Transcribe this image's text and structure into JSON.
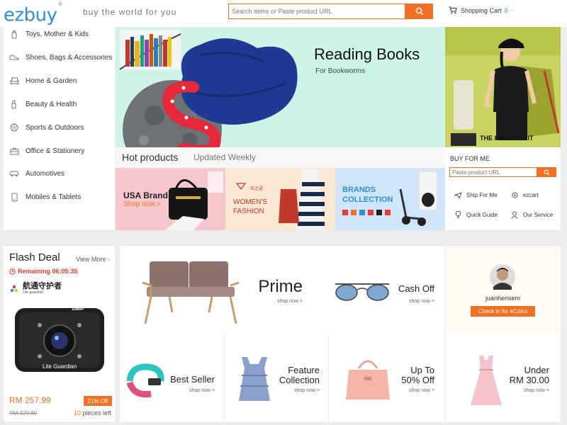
{
  "header": {
    "logo": "ezbuy",
    "logo_mark": "®",
    "tagline": "buy the world for you",
    "search_placeholder": "Search items or Paste product URL",
    "cart_label": "Shopping Cart",
    "cart_count": "0"
  },
  "sidebar": {
    "items": [
      {
        "label": "Toys, Mother & Kids",
        "icon": "baby-bottle-icon"
      },
      {
        "label": "Shoes, Bags & Accessories",
        "icon": "shoe-icon"
      },
      {
        "label": "Home & Garden",
        "icon": "sofa-icon"
      },
      {
        "label": "Beauty & Health",
        "icon": "cosmetics-icon"
      },
      {
        "label": "Sports & Outdoors",
        "icon": "ball-icon"
      },
      {
        "label": "Office & Stationery",
        "icon": "briefcase-icon"
      },
      {
        "label": "Automotives",
        "icon": "car-icon"
      },
      {
        "label": "Mobiles & Tablets",
        "icon": "phone-icon"
      }
    ]
  },
  "banner": {
    "title": "Reading Books",
    "subtitle": "For Bookworms",
    "side_text": "THE FINEST EDIT"
  },
  "hot": {
    "title": "Hot products",
    "subtitle": "Updated Weekly",
    "tiles": [
      {
        "title": "USA Brands",
        "link": "Shop now >"
      },
      {
        "title": "WOMEN'S\nFASHION",
        "brand": "衣之语"
      },
      {
        "title": "BRANDS\nCOLLECTION"
      }
    ]
  },
  "buy_for_me": {
    "title": "BUY FOR ME",
    "placeholder": "Paste product URL",
    "services": [
      {
        "label": "Ship For Me",
        "icon": "plane-icon"
      },
      {
        "label": "ezcart",
        "icon": "cart-gear-icon"
      },
      {
        "label": "Quick Guide",
        "icon": "bulb-icon"
      },
      {
        "label": "Our Service",
        "icon": "person-icon"
      }
    ]
  },
  "flash": {
    "title": "Flash Deal",
    "view_more": "View More",
    "remaining": "Remaining 06:05:35",
    "brand_cn": "航通守护者",
    "brand_en": "Lite guardian",
    "device_label": "Lite Guardian",
    "device_res": "1080P",
    "price": "RM 257.99",
    "discount": "21% Off",
    "old_price": "RM 329.80",
    "stock_number": "10",
    "stock_suffix": "pieces left"
  },
  "promos": {
    "prime": {
      "title": "Prime",
      "link": "shop now >"
    },
    "cash_off": {
      "title": "Cash Off",
      "link": "shop now >"
    },
    "best_seller": {
      "title": "Best Seller",
      "link": "shop now >"
    },
    "feature": {
      "title_line1": "Feature",
      "title_line2": "Collection",
      "link": "shop now >"
    },
    "up_to": {
      "title_line1": "Up To",
      "title_line2": "50% Off",
      "link": "shop now >"
    },
    "under": {
      "title_line1": "Under",
      "title_line2": "RM 30.00",
      "link": "shop now >"
    }
  },
  "user": {
    "name": "juanhensem",
    "button": "Check in for eCoins"
  },
  "colors": {
    "accent": "#f36f21",
    "brand": "#2d8fd5",
    "banner_bg": "#cdf4e6",
    "flash_red": "#e53935"
  }
}
